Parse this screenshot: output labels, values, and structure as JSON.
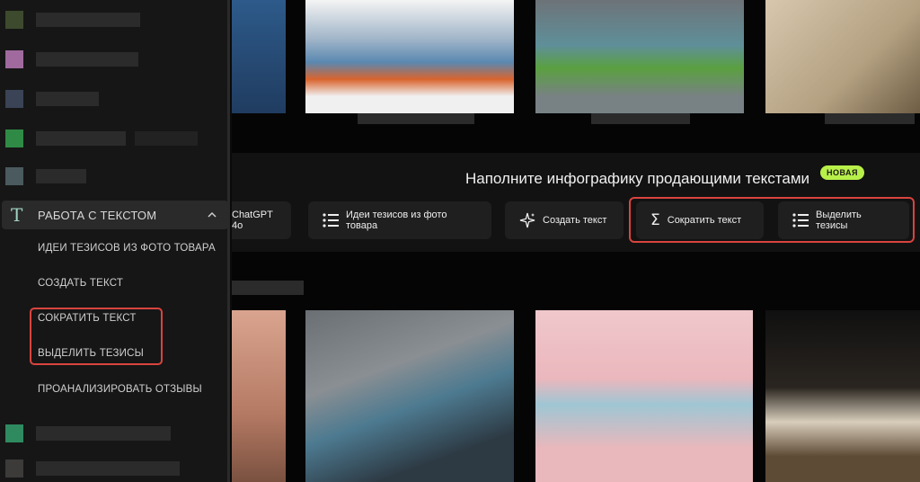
{
  "sidebar": {
    "section": {
      "icon": "text-t-icon",
      "label": "РАБОТА С ТЕКСТОМ",
      "expanded_icon": "chevron-up-icon"
    },
    "items": [
      {
        "label": "ИДЕИ ТЕЗИСОВ ИЗ ФОТО ТОВАРА"
      },
      {
        "label": "СОЗДАТЬ ТЕКСТ"
      },
      {
        "label": "СОКРАТИТЬ ТЕКСТ"
      },
      {
        "label": "ВЫДЕЛИТЬ ТЕЗИСЫ"
      },
      {
        "label": "ПРОАНАЛИЗИРОВАТЬ ОТЗЫВЫ"
      }
    ]
  },
  "banner": {
    "title": "Наполните инфографику продающими текстами",
    "badge": "НОВАЯ",
    "chips": [
      {
        "label": "ChatGPT 4o",
        "icon": ""
      },
      {
        "label": "Идеи тезисов из фото товара",
        "icon": "list-icon"
      },
      {
        "label": "Создать текст",
        "icon": "sparkle-icon"
      },
      {
        "label": "Сократить текст",
        "icon": "sigma-icon"
      },
      {
        "label": "Выделить тезисы",
        "icon": "list-icon"
      }
    ]
  },
  "colors": {
    "accent_green": "#b8f04a",
    "highlight_red": "#d9443f",
    "sidebar_bg": "#161616",
    "chip_bg": "#1f1f1f"
  }
}
